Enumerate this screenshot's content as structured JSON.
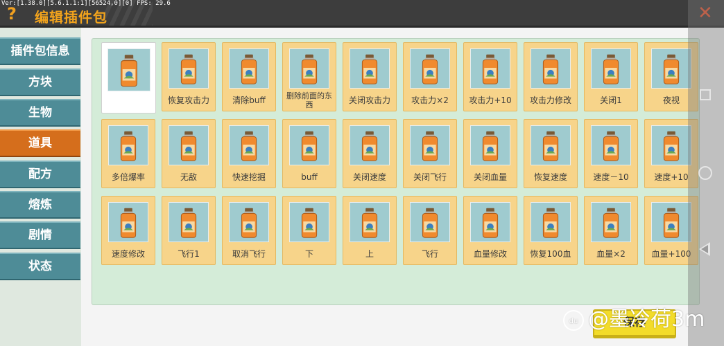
{
  "debug": "Ver:[1.38.0][5.6.1.1:1][56524,0][0] FPS: 29.6",
  "header": {
    "help_icon": "?",
    "title": "编辑插件包",
    "close_icon": "✕"
  },
  "sidebar": {
    "items": [
      {
        "label": "插件包信息",
        "active": false
      },
      {
        "label": "方块",
        "active": false
      },
      {
        "label": "生物",
        "active": false
      },
      {
        "label": "道具",
        "active": true
      },
      {
        "label": "配方",
        "active": false
      },
      {
        "label": "熔炼",
        "active": false
      },
      {
        "label": "剧情",
        "active": false
      },
      {
        "label": "状态",
        "active": false
      }
    ]
  },
  "items": [
    {
      "label": "",
      "selected": true
    },
    {
      "label": "恢复攻击力"
    },
    {
      "label": "清除buff"
    },
    {
      "label": "删除前面的东西"
    },
    {
      "label": "关闭攻击力"
    },
    {
      "label": "攻击力×2"
    },
    {
      "label": "攻击力+10"
    },
    {
      "label": "攻击力修改"
    },
    {
      "label": "关闭1"
    },
    {
      "label": "夜视"
    },
    {
      "label": "多倍爆率"
    },
    {
      "label": "无敌"
    },
    {
      "label": "快速挖掘"
    },
    {
      "label": "buff"
    },
    {
      "label": "关闭速度"
    },
    {
      "label": "关闭飞行"
    },
    {
      "label": "关闭血量"
    },
    {
      "label": "恢复速度"
    },
    {
      "label": "速度－10"
    },
    {
      "label": "速度+10"
    },
    {
      "label": "速度修改"
    },
    {
      "label": "飞行1"
    },
    {
      "label": "取消飞行"
    },
    {
      "label": "下"
    },
    {
      "label": "上"
    },
    {
      "label": "飞行"
    },
    {
      "label": "血量修改"
    },
    {
      "label": "恢复100血"
    },
    {
      "label": "血量×2"
    },
    {
      "label": "血量+100"
    }
  ],
  "save_button": {
    "label": "保存"
  },
  "watermark": {
    "logo": "du",
    "text": "@墨冷荷3m"
  },
  "colors": {
    "accent_active": "#d56e1c",
    "sidebar": "#4e8c97",
    "tile": "#f7d48a",
    "title": "#f3a41c",
    "close": "#f0522a",
    "save": "#f3dc2a"
  }
}
